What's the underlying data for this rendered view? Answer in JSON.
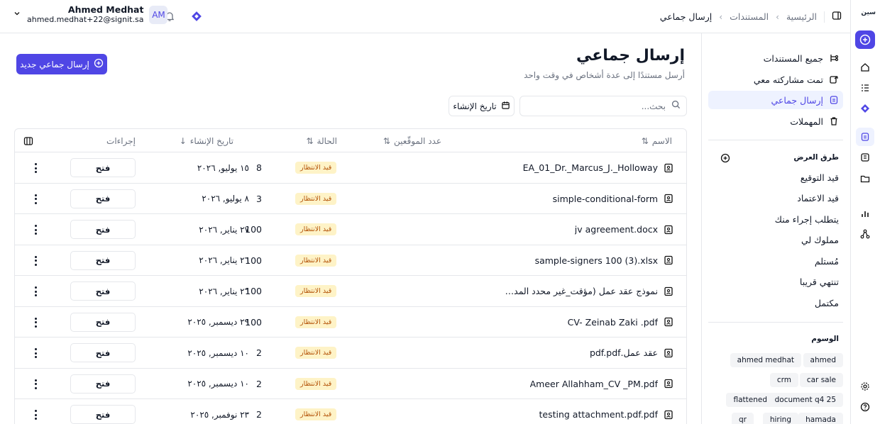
{
  "rail": {
    "logo": "سين"
  },
  "header": {
    "breadcrumb": {
      "home": "الرئيسية",
      "documents": "المستندات",
      "current": "إرسال جماعي"
    },
    "user": {
      "name": "Ahmed Medhat",
      "email": "ahmed.medhat+22@signit.sa",
      "initials": "AM"
    }
  },
  "sidebar": {
    "nav": [
      {
        "label": "جميع المستندات",
        "icon": "all-documents-icon"
      },
      {
        "label": "تمت مشاركته معي",
        "icon": "shared-icon"
      },
      {
        "label": "إرسال جماعي",
        "icon": "bulk-send-icon",
        "active": true
      },
      {
        "label": "المهملات",
        "icon": "trash-icon"
      }
    ],
    "views_title": "طرق العرض",
    "views": [
      "قيد التوقيع",
      "قيد الاعتماد",
      "يتطلب إجراء منك",
      "مملوك لي",
      "مُستلم",
      "تنتهي قريبا",
      "مكتمل"
    ],
    "tags_title": "الوسوم",
    "tags": [
      "ahmed",
      "ahmed medhat",
      "car sale",
      "crm",
      "document q4 25",
      "flattened",
      "hamada",
      "hiring",
      "qr"
    ]
  },
  "page": {
    "title": "إرسال جماعي",
    "subtitle": "أرسل مستندًا إلى عدة أشخاص في وقت واحد",
    "new_button": "إرسال جماعي جديد",
    "search_placeholder": "بحث...",
    "date_filter": "تاريخ الإنشاء"
  },
  "table": {
    "columns": {
      "name": "الاسم",
      "signers": "عدد الموقّعين",
      "status": "الحالة",
      "created": "تاريخ الإنشاء",
      "actions": "إجراءات"
    },
    "open_label": "فتح",
    "rows": [
      {
        "name": "EA_01_Dr._Marcus_J._Holloway",
        "signers": "8",
        "status": "قيد الانتظار",
        "created": "١٥ يوليو, ٢٠٢٦"
      },
      {
        "name": "simple-conditional-form",
        "signers": "3",
        "status": "قيد الانتظار",
        "created": "٨ يوليو, ٢٠٢٦"
      },
      {
        "name": "jv agreement.docx",
        "signers": "100",
        "status": "قيد الانتظار",
        "created": "٢٧ يناير, ٢٠٢٦"
      },
      {
        "name": "sample-signers 100 (3).xlsx",
        "signers": "100",
        "status": "قيد الانتظار",
        "created": "٢٦ يناير, ٢٠٢٦"
      },
      {
        "name": "نموذج عقد عمل (مؤقت_غير محدد المدة...",
        "signers": "100",
        "status": "قيد الانتظار",
        "created": "٢٦ يناير, ٢٠٢٦"
      },
      {
        "name": "CV- Zeinab Zaki .pdf",
        "signers": "100",
        "status": "قيد الانتظار",
        "created": "٢٩ ديسمبر, ٢٠٢٥"
      },
      {
        "name": "عقد عمل.pdf.pdf",
        "signers": "2",
        "status": "قيد الانتظار",
        "created": "١٠ ديسمبر, ٢٠٢٥"
      },
      {
        "name": "Ameer Allahham_CV _PM.pdf",
        "signers": "2",
        "status": "قيد الانتظار",
        "created": "١٠ ديسمبر, ٢٠٢٥"
      },
      {
        "name": "testing attachment.pdf.pdf",
        "signers": "2",
        "status": "قيد الانتظار",
        "created": "٢٣ نوفمبر, ٢٠٢٥"
      }
    ]
  },
  "colors": {
    "accent": "#4f46e5",
    "pending_bg": "#fef3c7",
    "pending_text": "#b45309",
    "border": "#e5e7eb"
  }
}
